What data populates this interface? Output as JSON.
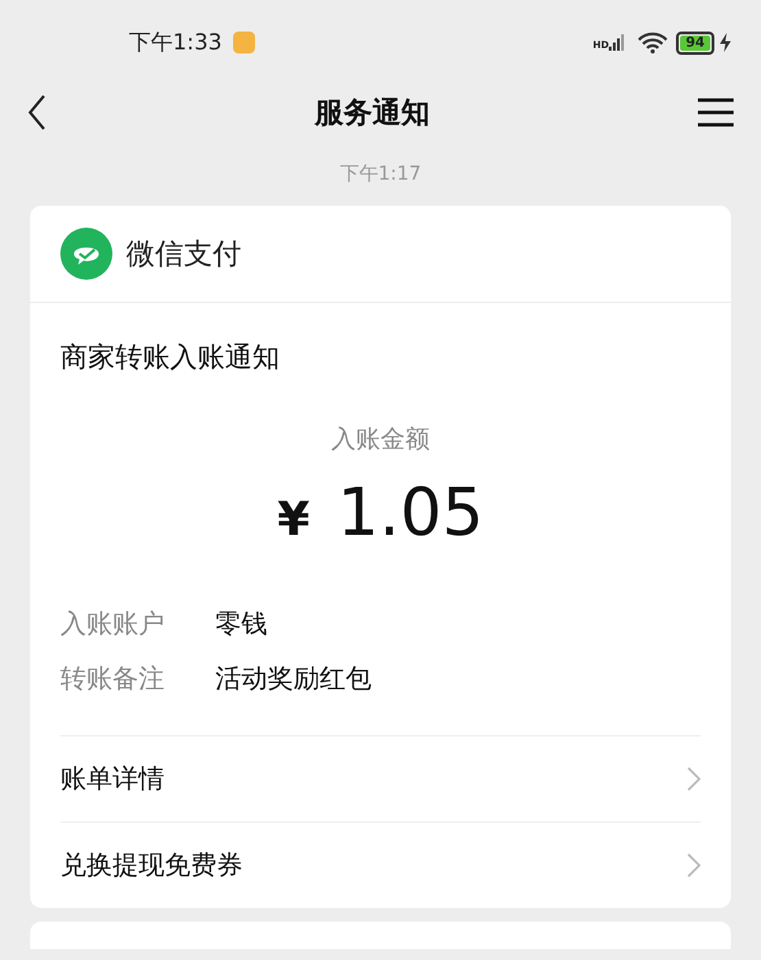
{
  "status_bar": {
    "time": "下午1:33",
    "network": "HD",
    "battery": "94"
  },
  "nav": {
    "title": "服务通知"
  },
  "timestamp": "下午1:17",
  "card": {
    "app_name": "微信支付",
    "title": "商家转账入账通知",
    "amount_label": "入账金额",
    "currency": "¥",
    "amount": "1.05",
    "fields": [
      {
        "label": "入账账户",
        "value": "零钱"
      },
      {
        "label": "转账备注",
        "value": "活动奖励红包"
      }
    ],
    "links": [
      {
        "label": "账单详情"
      },
      {
        "label": "兑换提现免费券"
      }
    ]
  }
}
